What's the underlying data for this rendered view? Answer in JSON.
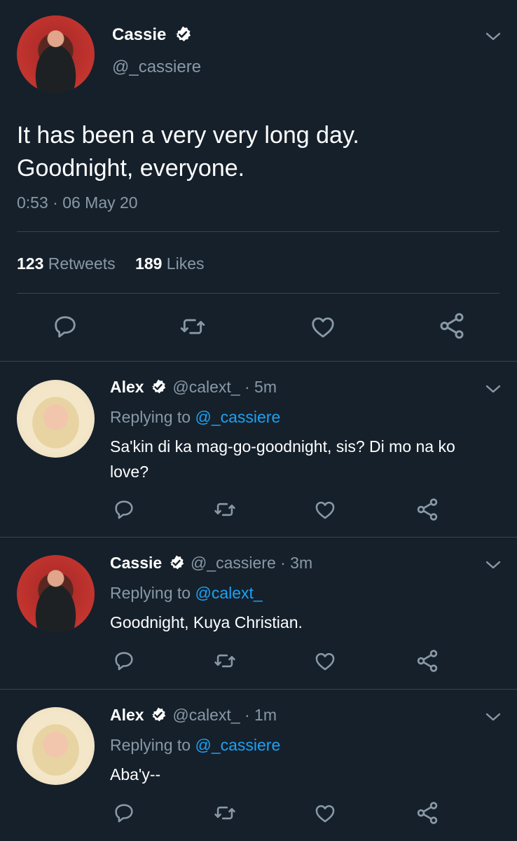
{
  "main_tweet": {
    "name": "Cassie",
    "handle": "@_cassiere",
    "text_line1": "It has been a very very long day.",
    "text_line2": "Goodnight, everyone.",
    "timestamp": "0:53 · 06 May 20",
    "retweet_count": "123",
    "retweet_label": "Retweets",
    "like_count": "189",
    "like_label": "Likes"
  },
  "replies": [
    {
      "name": "Alex",
      "meta": "@calext_ · 5m",
      "replying_label": "Replying to",
      "replying_handle": "@_cassiere",
      "text_line1": "Sa'kin di ka mag-go-goodnight, sis? Di mo na ko",
      "text_line2": "love?"
    },
    {
      "name": "Cassie",
      "meta": "@_cassiere · 3m",
      "replying_label": "Replying to",
      "replying_handle": "@calext_",
      "text_line1": "Goodnight, Kuya Christian.",
      "text_line2": ""
    },
    {
      "name": "Alex",
      "meta": "@calext_ · 1m",
      "replying_label": "Replying to",
      "replying_handle": "@_cassiere",
      "text_line1": "Aba'y--",
      "text_line2": ""
    }
  ],
  "colors": {
    "background": "#15202b",
    "muted": "#8899a6",
    "link": "#1da1f2",
    "divider": "#38444d"
  },
  "icons": [
    "reply-icon",
    "retweet-icon",
    "like-icon",
    "share-icon",
    "verified-badge-icon",
    "chevron-down-icon"
  ]
}
